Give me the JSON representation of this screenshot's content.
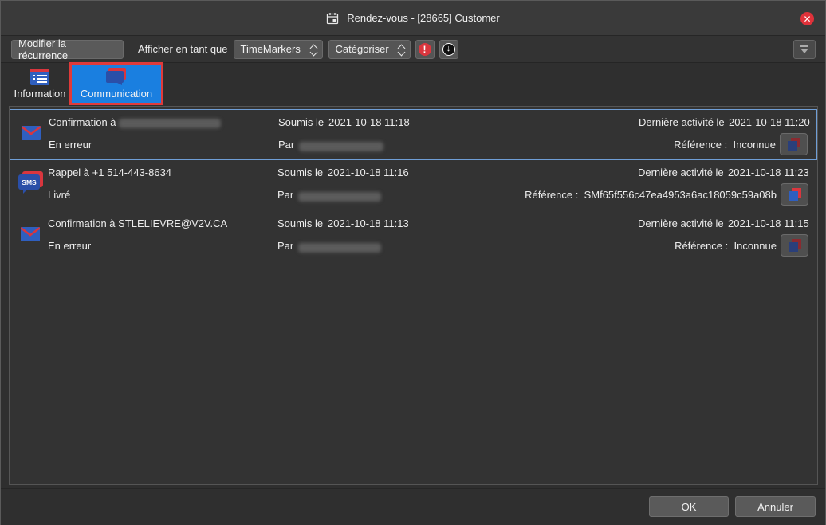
{
  "window": {
    "title": "Rendez-vous - [28665] Customer"
  },
  "toolbar": {
    "recurrence_button": "Modifier la récurrence",
    "display_as_label": "Afficher en tant que",
    "display_as_value": "TimeMarkers",
    "categorize_value": "Catégoriser"
  },
  "tabs": [
    {
      "label": "Information",
      "selected": false
    },
    {
      "label": "Communication",
      "selected": true
    }
  ],
  "communications": [
    {
      "type": "email",
      "title": "Confirmation à",
      "status": "En erreur",
      "submitted_label": "Soumis le",
      "submitted": "2021-10-18 11:18",
      "by_label": "Par",
      "last_activity_label": "Dernière activité le",
      "last_activity": "2021-10-18 11:20",
      "reference_label": "Référence :",
      "reference": "Inconnue",
      "selected": true
    },
    {
      "type": "sms",
      "icon_text": "SMS",
      "title": "Rappel à +1 514-443-8634",
      "status": "Livré",
      "submitted_label": "Soumis le",
      "submitted": "2021-10-18 11:16",
      "by_label": "Par",
      "last_activity_label": "Dernière activité le",
      "last_activity": "2021-10-18 11:23",
      "reference_label": "Référence :",
      "reference": "SMf65f556c47ea4953a6ac18059c59a08b",
      "selected": false
    },
    {
      "type": "email",
      "title": "Confirmation à STLELIEVRE@V2V.CA",
      "status": "En erreur",
      "submitted_label": "Soumis le",
      "submitted": "2021-10-18 11:13",
      "by_label": "Par",
      "last_activity_label": "Dernière activité le",
      "last_activity": "2021-10-18 11:15",
      "reference_label": "Référence :",
      "reference": "Inconnue",
      "selected": false
    }
  ],
  "footer": {
    "ok_label": "OK",
    "cancel_label": "Annuler"
  },
  "colors": {
    "accent": "#1a7fe0",
    "highlight_outline": "#e03a3a",
    "close": "#e0323a",
    "email_icon": "#2f5fbf",
    "sms_icon": "#2a4fa8"
  }
}
